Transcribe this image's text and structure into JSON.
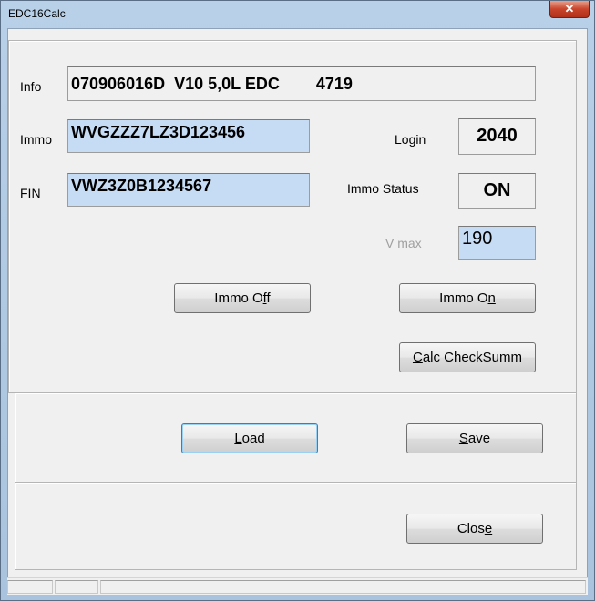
{
  "window": {
    "title": "EDC16Calc",
    "close_glyph": "✕"
  },
  "info": {
    "label": "Info",
    "value": "070906016D  V10 5,0L EDC        4719"
  },
  "immo": {
    "label": "Immo",
    "value": "WVGZZZ7LZ3D123456"
  },
  "fin": {
    "label": "FIN",
    "value": "VWZ3Z0B1234567"
  },
  "login": {
    "label": "Login",
    "value": "2040"
  },
  "immo_status": {
    "label": "Immo Status",
    "value": "ON"
  },
  "vmax": {
    "label": "V max",
    "value": "190"
  },
  "buttons": {
    "immo_off": {
      "label_pre": "Immo O",
      "label_ul": "f",
      "label_post": "f"
    },
    "immo_on": {
      "label_pre": "Immo O",
      "label_ul": "n",
      "label_post": ""
    },
    "calc": {
      "label_pre": "",
      "label_ul": "C",
      "label_post": "alc CheckSumm"
    },
    "load": {
      "label_pre": "",
      "label_ul": "L",
      "label_post": "oad"
    },
    "save": {
      "label_pre": "",
      "label_ul": "S",
      "label_post": "ave"
    },
    "close": {
      "label_pre": "Clos",
      "label_ul": "e",
      "label_post": ""
    }
  },
  "colors": {
    "field_blue": "#c6dcf5",
    "titlebar": "#b8d0e8",
    "close_red": "#c8442a"
  }
}
